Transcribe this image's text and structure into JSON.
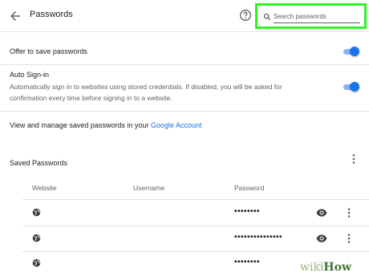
{
  "header": {
    "back_icon": "arrow-left-icon",
    "title": "Passwords",
    "help_icon": "help-circle-icon"
  },
  "search": {
    "icon": "search-icon",
    "placeholder": "Search passwords",
    "value": "",
    "highlight_color": "#2df51f"
  },
  "settings": {
    "offer_to_save": {
      "label": "Offer to save passwords",
      "enabled": true
    },
    "auto_signin": {
      "label": "Auto Sign-in",
      "description": "Automatically sign in to websites using stored credentials. If disabled, you will be asked for confirmation every time before signing in to a website.",
      "enabled": true
    },
    "manage": {
      "text": "View and manage saved passwords in your",
      "link": "Google Account"
    }
  },
  "saved": {
    "title": "Saved Passwords",
    "columns": [
      "Website",
      "Username",
      "Password"
    ],
    "rows": [
      {
        "site_icon": "globe-icon",
        "website": "",
        "username": "",
        "password": "••••••••"
      },
      {
        "site_icon": "globe-icon",
        "website": "",
        "username": "",
        "password": "•••••••••••••••"
      },
      {
        "site_icon": "globe-icon",
        "website": "",
        "username": "",
        "password": "••••••••"
      }
    ]
  },
  "watermark": {
    "wiki": "wiki",
    "how": "How"
  },
  "colors": {
    "accent": "#1a73e8",
    "toggle_track": "#8ab4f8",
    "text_primary": "#202124",
    "text_secondary": "#5f6368"
  }
}
